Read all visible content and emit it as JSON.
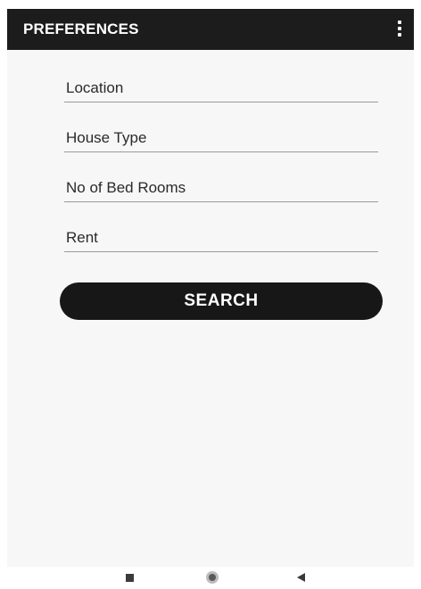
{
  "app_bar": {
    "title": "PREFERENCES",
    "overflow_icon": "more-vert-icon",
    "background": "#1c1c1c"
  },
  "form": {
    "location_placeholder": "Location",
    "house_type_placeholder": "House Type",
    "bedrooms_placeholder": "No of Bed Rooms",
    "rent_placeholder": "Rent"
  },
  "search_button": {
    "label": "SEARCH",
    "background": "#171717"
  },
  "nav_bar": {
    "recents_icon": "square-icon",
    "home_icon": "circle-icon",
    "back_icon": "triangle-back-icon"
  }
}
